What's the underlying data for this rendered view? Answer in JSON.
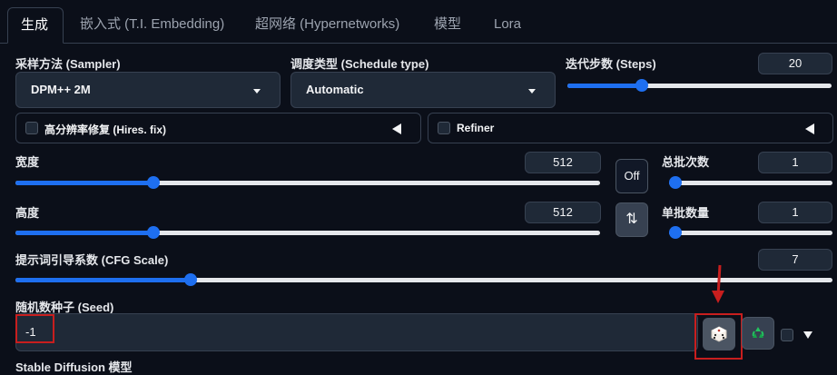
{
  "tabs": [
    {
      "label": "生成",
      "active": true
    },
    {
      "label": "嵌入式 (T.I. Embedding)"
    },
    {
      "label": "超网络 (Hypernetworks)"
    },
    {
      "label": "模型"
    },
    {
      "label": "Lora"
    }
  ],
  "sampler": {
    "label": "采样方法 (Sampler)",
    "value": "DPM++ 2M"
  },
  "schedule": {
    "label": "调度类型 (Schedule type)",
    "value": "Automatic"
  },
  "steps": {
    "label": "迭代步数 (Steps)",
    "value": "20",
    "level": 0.27
  },
  "hires": {
    "label": "高分辨率修复 (Hires. fix)",
    "checked": false
  },
  "refiner": {
    "label": "Refiner",
    "checked": false
  },
  "width": {
    "label": "宽度",
    "value": "512",
    "level": 0.23
  },
  "height": {
    "label": "高度",
    "value": "512",
    "level": 0.23
  },
  "off_button": {
    "label": "Off"
  },
  "swap_button": {
    "label": "⇅"
  },
  "batch_count": {
    "label": "总批次数",
    "value": "1",
    "level": 0.0
  },
  "batch_size": {
    "label": "单批数量",
    "value": "1",
    "level": 0.0
  },
  "cfg": {
    "label": "提示词引导系数 (CFG Scale)",
    "value": "7",
    "level": 0.21
  },
  "seed": {
    "label": "随机数种子 (Seed)",
    "value": "-1"
  },
  "dice_icon": "dice-icon",
  "recycle_icon": "recycle-icon",
  "sd_model": {
    "label": "Stable Diffusion 模型"
  },
  "colors": {
    "accent": "#1e6ff0",
    "highlight": "#c81e1e",
    "background": "#0b0f19"
  }
}
